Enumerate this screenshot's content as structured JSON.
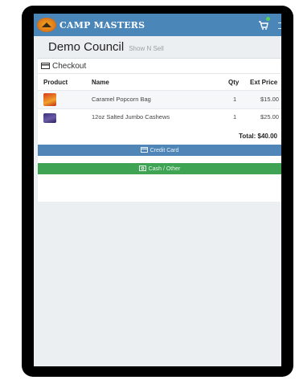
{
  "app": {
    "brand": "CAMP MASTERS"
  },
  "header": {
    "title": "Demo Council",
    "subtitle": "Show N Sell"
  },
  "checkout": {
    "label": "Checkout",
    "columns": {
      "product": "Product",
      "name": "Name",
      "qty": "Qty",
      "price": "Ext Price"
    },
    "items": [
      {
        "name": "Caramel Popcorn Bag",
        "qty": "1",
        "price": "$15.00"
      },
      {
        "name": "12oz Salted Jumbo Cashews",
        "qty": "1",
        "price": "$25.00"
      }
    ],
    "total": "Total: $40.00",
    "credit_label": "Credit Card",
    "cash_label": "Cash / Other"
  },
  "colors": {
    "navbar": "#4a86b8",
    "credit_button": "#4f86b7",
    "cash_button": "#3ea454"
  },
  "icons": [
    "logo-icon",
    "cart-icon",
    "menu-icon",
    "credit-card-icon",
    "cash-icon"
  ]
}
